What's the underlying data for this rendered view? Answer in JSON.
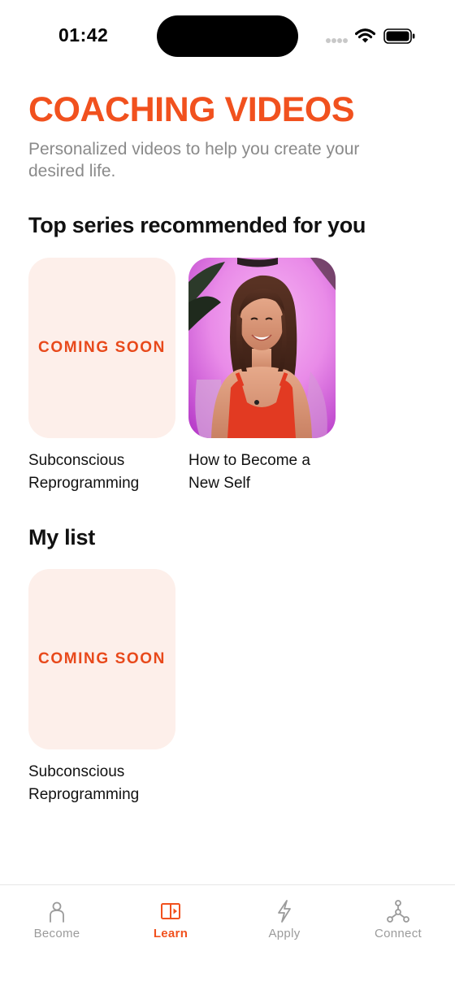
{
  "status_bar": {
    "time": "01:42"
  },
  "header": {
    "title": "COACHING VIDEOS",
    "subtitle": "Personalized videos to help you create your desired life."
  },
  "sections": {
    "top_series": {
      "title": "Top series recommended for you",
      "items": [
        {
          "thumb_text": "COMING SOON",
          "title": "Subconscious\nReprogramming"
        },
        {
          "thumb_image": "woman-in-red-top-photo",
          "title": "How to Become a\nNew Self"
        }
      ]
    },
    "my_list": {
      "title": "My list",
      "items": [
        {
          "thumb_text": "COMING SOON",
          "title": "Subconscious\nReprogramming"
        }
      ]
    }
  },
  "tab_bar": {
    "tabs": [
      {
        "label": "Become",
        "icon": "person-icon",
        "active": false
      },
      {
        "label": "Learn",
        "icon": "book-play-icon",
        "active": true
      },
      {
        "label": "Apply",
        "icon": "lightning-icon",
        "active": false
      },
      {
        "label": "Connect",
        "icon": "network-icon",
        "active": false
      }
    ]
  },
  "colors": {
    "accent": "#F1511E",
    "placeholder_bg": "#FDEFEA",
    "inactive_tab": "#9B9B9B"
  }
}
